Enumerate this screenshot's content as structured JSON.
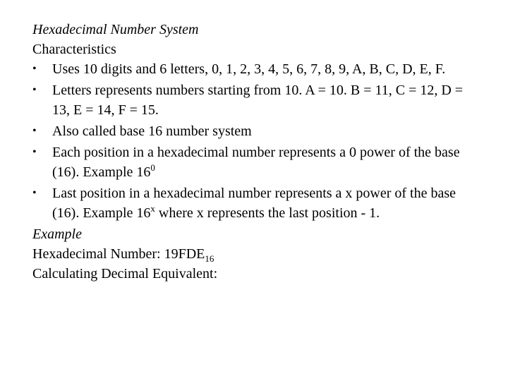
{
  "title": "Hexadecimal Number System",
  "subtitle": "Characteristics",
  "bullet_glyph": "•",
  "bullets": [
    {
      "text": "Uses 10 digits and 6 letters, 0, 1, 2, 3, 4, 5, 6, 7, 8, 9, A, B, C, D, E, F."
    },
    {
      "text": "Letters represents numbers starting from 10. A = 10. B = 11, C = 12, D = 13, E = 14, F = 15."
    },
    {
      "text": "Also called base 16 number system"
    },
    {
      "text": "Each position in a hexadecimal number represents a 0 power of the base (16). Example 16",
      "sup": "0",
      "after": ""
    },
    {
      "text": "Last position in a hexadecimal number represents a x power of the base (16). Example 16",
      "sup": "x",
      "after": " where x represents the last position - 1."
    }
  ],
  "example_heading": "Example",
  "hex_number_label": "Hexadecimal Number: 19FDE",
  "hex_number_base": "16",
  "calc_label": "Calculating Decimal Equivalent:"
}
